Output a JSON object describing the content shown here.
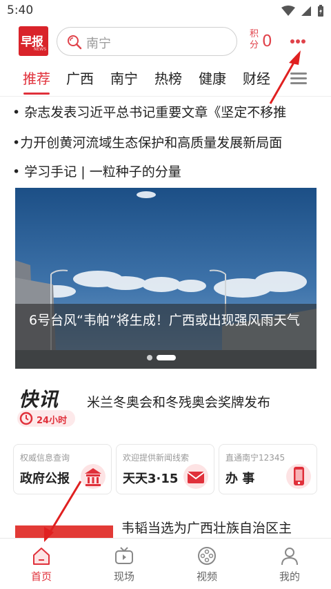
{
  "status_bar": {
    "time": "5:40"
  },
  "header": {
    "logo_text": "早报",
    "logo_subtext": "NEWS",
    "search_placeholder": "南宁",
    "points_label": "积分",
    "points_value": "0",
    "more_icon": "more-dots-icon"
  },
  "tabs": [
    {
      "label": "推荐",
      "active": true
    },
    {
      "label": "广西"
    },
    {
      "label": "南宁"
    },
    {
      "label": "热榜"
    },
    {
      "label": "健康"
    },
    {
      "label": "财经"
    }
  ],
  "headlines": [
    "• 杂志发表习近平总书记重要文章《坚定不移推",
    "•᠌力开创黄河流域生态保护和高质量发展新局面",
    "• 学习手记 | 一粒种子的分量"
  ],
  "banner": {
    "caption": "6号台风“韦帕”将生成！广西或出现强风雨天气",
    "slide_count": 2,
    "active_slide": 2
  },
  "flash": {
    "logo": "快讯",
    "badge": "24小时",
    "title": "米兰冬奥会和冬残奥会奖牌发布"
  },
  "services": [
    {
      "subtitle": "权威信息查询",
      "title": "政府公报",
      "icon": "government-building-icon"
    },
    {
      "subtitle": "欢迎提供新闻线索",
      "title": "天天3·15",
      "icon": "envelope-icon"
    },
    {
      "subtitle": "直通南宁12345",
      "title": "办 事",
      "icon": "phone-icon"
    }
  ],
  "news_item": {
    "title": "韦韬当选为广西壮族自治区主"
  },
  "bottom_nav": [
    {
      "label": "首页",
      "icon": "home-icon",
      "active": true
    },
    {
      "label": "现场",
      "icon": "tv-icon"
    },
    {
      "label": "视频",
      "icon": "film-reel-icon"
    },
    {
      "label": "我的",
      "icon": "person-icon"
    }
  ],
  "colors": {
    "accent": "#e0303a",
    "logo_red": "#d9232a"
  }
}
